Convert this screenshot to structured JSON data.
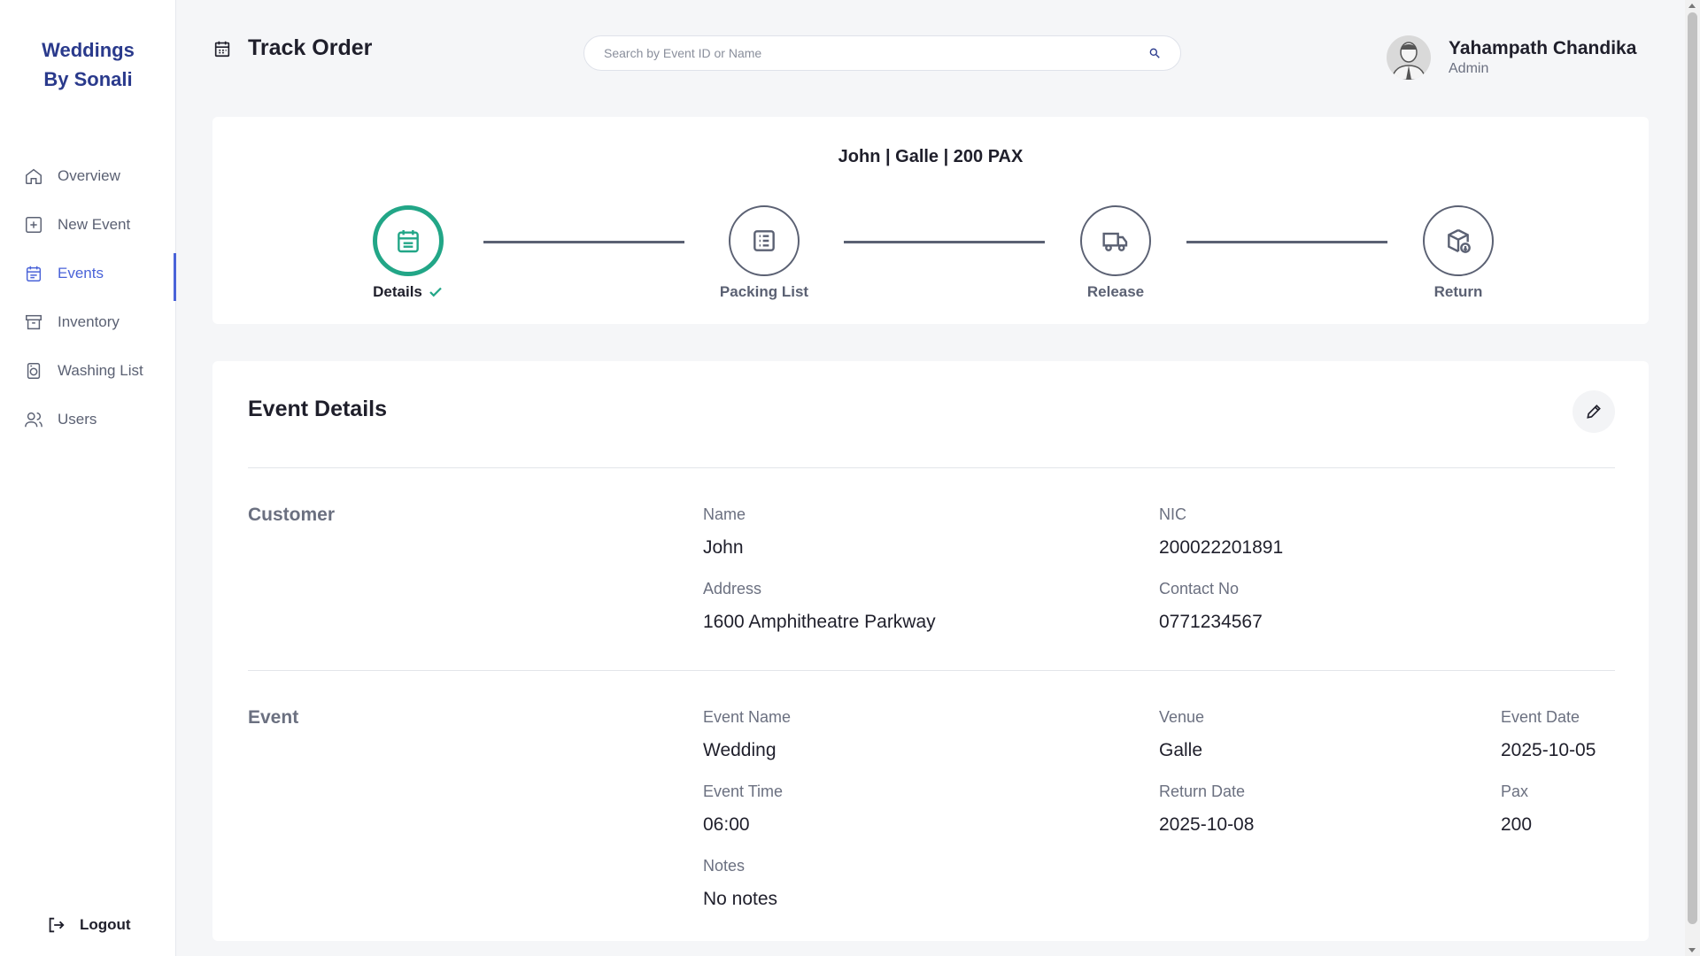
{
  "app": {
    "brand_line1": "Weddings",
    "brand_line2": "By Sonali"
  },
  "sidebar": {
    "items": [
      {
        "label": "Overview",
        "icon": "home-icon"
      },
      {
        "label": "New Event",
        "icon": "plus-square-icon"
      },
      {
        "label": "Events",
        "icon": "calendar-icon",
        "active": true
      },
      {
        "label": "Inventory",
        "icon": "archive-icon"
      },
      {
        "label": "Washing List",
        "icon": "washing-machine-icon"
      },
      {
        "label": "Users",
        "icon": "users-icon"
      }
    ],
    "logout_label": "Logout"
  },
  "header": {
    "title": "Track Order",
    "search_placeholder": "Search by Event ID or Name",
    "user_name": "Yahampath Chandika",
    "user_role": "Admin"
  },
  "progress": {
    "title": "John | Galle | 200 PAX",
    "steps": [
      {
        "label": "Details",
        "icon": "calendar-icon",
        "done": true
      },
      {
        "label": "Packing List",
        "icon": "list-icon",
        "done": false
      },
      {
        "label": "Release",
        "icon": "truck-icon",
        "done": false
      },
      {
        "label": "Return",
        "icon": "package-return-icon",
        "done": false
      }
    ]
  },
  "details": {
    "title": "Event Details",
    "customer_section": "Customer",
    "customer": {
      "name_label": "Name",
      "name": "John",
      "nic_label": "NIC",
      "nic": "200022201891",
      "address_label": "Address",
      "address": "1600 Amphitheatre Parkway",
      "contact_label": "Contact No",
      "contact": "0771234567"
    },
    "event_section": "Event",
    "event": {
      "name_label": "Event Name",
      "name": "Wedding",
      "venue_label": "Venue",
      "venue": "Galle",
      "date_label": "Event Date",
      "date": "2025-10-05",
      "time_label": "Event Time",
      "time": "06:00",
      "return_label": "Return Date",
      "return_date": "2025-10-08",
      "pax_label": "Pax",
      "pax": "200",
      "notes_label": "Notes",
      "notes": "No notes"
    }
  },
  "colors": {
    "brand": "#2a3a8c",
    "accent": "#4a63d8",
    "success": "#22a687"
  }
}
